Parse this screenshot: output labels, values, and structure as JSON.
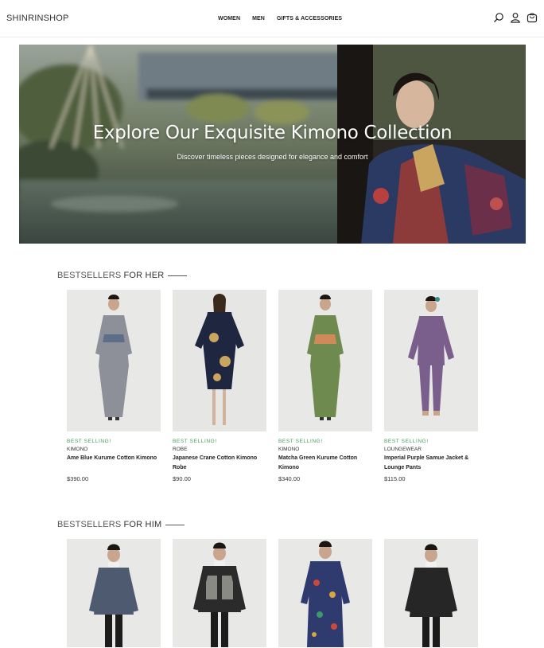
{
  "brand": {
    "logo": "SHINRINSHOP"
  },
  "nav": {
    "items": [
      "WOMEN",
      "MEN",
      "GIFTS & ACCESSORIES"
    ]
  },
  "header_icons": [
    "search-icon",
    "user-icon",
    "bag-icon"
  ],
  "hero": {
    "title": "Explore Our Exquisite Kimono Collection",
    "subtitle": "Discover timeless pieces designed for elegance and comfort"
  },
  "her": {
    "title_prefix": "BESTSELLERS",
    "title_accent": "FOR HER",
    "products": [
      {
        "badge": "BEST SELLING!",
        "category": "KIMONO",
        "name": "Ame Blue Kurume Cotton Kimono",
        "price": "$390.00",
        "color": "#8d8f99"
      },
      {
        "badge": "BEST SELLING!",
        "category": "ROBE",
        "name": "Japanese Crane Cotton Kimono Robe",
        "price": "$90.00",
        "color": "#1f2640"
      },
      {
        "badge": "BEST SELLING!",
        "category": "KIMONO",
        "name": "Matcha Green Kurume Cotton Kimono",
        "price": "$340.00",
        "color": "#6e8a4f"
      },
      {
        "badge": "BEST SELLING!",
        "category": "LOUNGEWEAR",
        "name": "Imperial Purple Samue Jacket & Lounge Pants",
        "price": "$115.00",
        "color": "#7a5f8d"
      }
    ]
  },
  "him": {
    "title_prefix": "BESTSELLERS",
    "title_accent": "FOR HIM",
    "products": [
      {
        "color": "#4d5a70"
      },
      {
        "color": "#2b2b2b"
      },
      {
        "color": "#2f3a6e"
      },
      {
        "color": "#262626"
      }
    ]
  },
  "colors": {
    "badge_green": "#4a9a5a",
    "text_dark": "#222222"
  }
}
